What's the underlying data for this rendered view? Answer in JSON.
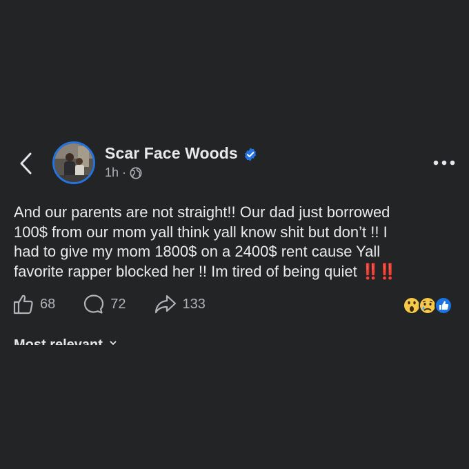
{
  "post": {
    "author": "Scar Face Woods",
    "timestamp": "1h",
    "separator": "·",
    "body": "And our parents are not straight!! Our dad just borrowed\n100$ from our mom yall think yall know shit but don’t !! I\nhad to give my mom 1800$ on a 2400$ rent cause Yall\nfavorite rapper blocked her !! Im tired of being quiet",
    "trailing_emoji": "‼️‼️"
  },
  "actions": {
    "likes": "68",
    "comments": "72",
    "shares": "133"
  },
  "comments_sort": {
    "label": "Most relevant"
  },
  "icons": {
    "back": "chevron-left-icon",
    "verified": "verified-badge-icon",
    "privacy": "globe-icon",
    "more": "more-dots-icon",
    "like": "thumbs-up-icon",
    "comment": "comment-bubble-icon",
    "share": "share-arrow-icon",
    "reactions": [
      "wow-reaction-icon",
      "sad-reaction-icon",
      "like-reaction-icon"
    ]
  },
  "colors": {
    "background": "#232425",
    "accent": "#2374e1",
    "text_primary": "#e9eaed",
    "text_secondary": "#b0b3b8",
    "alert_red": "#e02a2a"
  }
}
